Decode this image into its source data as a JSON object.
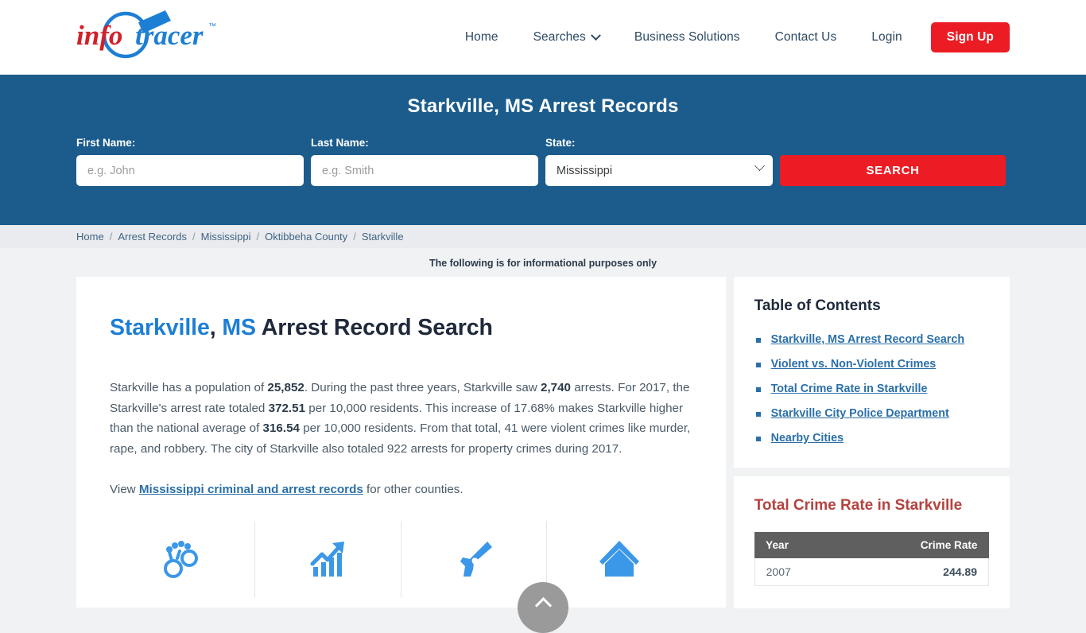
{
  "header": {
    "logo": {
      "part1": "info",
      "part2": "tracer",
      "tm": "™",
      "name": "infotracer-logo"
    },
    "nav": [
      {
        "label": "Home",
        "name": "nav-home"
      },
      {
        "label": "Searches",
        "name": "nav-searches",
        "has_caret": true
      },
      {
        "label": "Business Solutions",
        "name": "nav-business-solutions"
      },
      {
        "label": "Contact Us",
        "name": "nav-contact-us"
      },
      {
        "label": "Login",
        "name": "nav-login"
      }
    ],
    "signup_label": "Sign Up"
  },
  "banner": {
    "title": "Starkville, MS Arrest Records",
    "first_name_label": "First Name:",
    "first_name_placeholder": "e.g. John",
    "first_name_value": "",
    "last_name_label": "Last Name:",
    "last_name_placeholder": "e.g. Smith",
    "last_name_value": "",
    "state_label": "State:",
    "state_selected": "Mississippi",
    "search_label": "SEARCH",
    "background_color": "#1b5c8c",
    "button_color": "#ec1c24"
  },
  "breadcrumb": {
    "items": [
      "Home",
      "Arrest Records",
      "Mississippi",
      "Oktibbeha County",
      "Starkville"
    ],
    "separator": "/"
  },
  "notice": "The following is for informational purposes only",
  "main": {
    "heading": {
      "city": "Starkville",
      "comma": ", ",
      "state": "MS",
      "rest": " Arrest Record Search"
    },
    "paragraph": {
      "s1": "Starkville has a population of ",
      "population": "25,852",
      "s2": ". During the past three years, Starkville saw ",
      "arrests": "2,740",
      "s3": " arrests. For 2017, the Starkville's arrest rate totaled ",
      "arrest_rate": "372.51",
      "s4": " per 10,000 residents. This increase of 17.68% makes Starkville higher than the national average of ",
      "national_average": "316.54",
      "s5": " per 10,000 residents. From that total, 41 were violent crimes like murder, rape, and robbery. The city of Starkville also totaled 922 arrests for property crimes during 2017."
    },
    "view_line": {
      "prefix": "View ",
      "link": "Mississippi criminal and arrest records",
      "suffix": " for other counties."
    },
    "icons": [
      {
        "name": "handcuffs-icon"
      },
      {
        "name": "growth-chart-icon"
      },
      {
        "name": "handgun-icon"
      },
      {
        "name": "house-icon"
      }
    ]
  },
  "sidebar": {
    "toc_title": "Table of Contents",
    "toc_items": [
      "Starkville, MS Arrest Record Search",
      "Violent vs. Non-Violent Crimes",
      "Total Crime Rate in Starkville",
      "Starkville City Police Department",
      "Nearby Cities"
    ],
    "crime_title": "Total Crime Rate in Starkville",
    "crime_table": {
      "columns": [
        "Year",
        "Crime Rate"
      ],
      "rows": [
        {
          "year": "2007",
          "rate": "244.89"
        }
      ]
    }
  },
  "scroll_top": {
    "name": "scroll-to-top-button",
    "icon": "chevron-up-icon"
  }
}
